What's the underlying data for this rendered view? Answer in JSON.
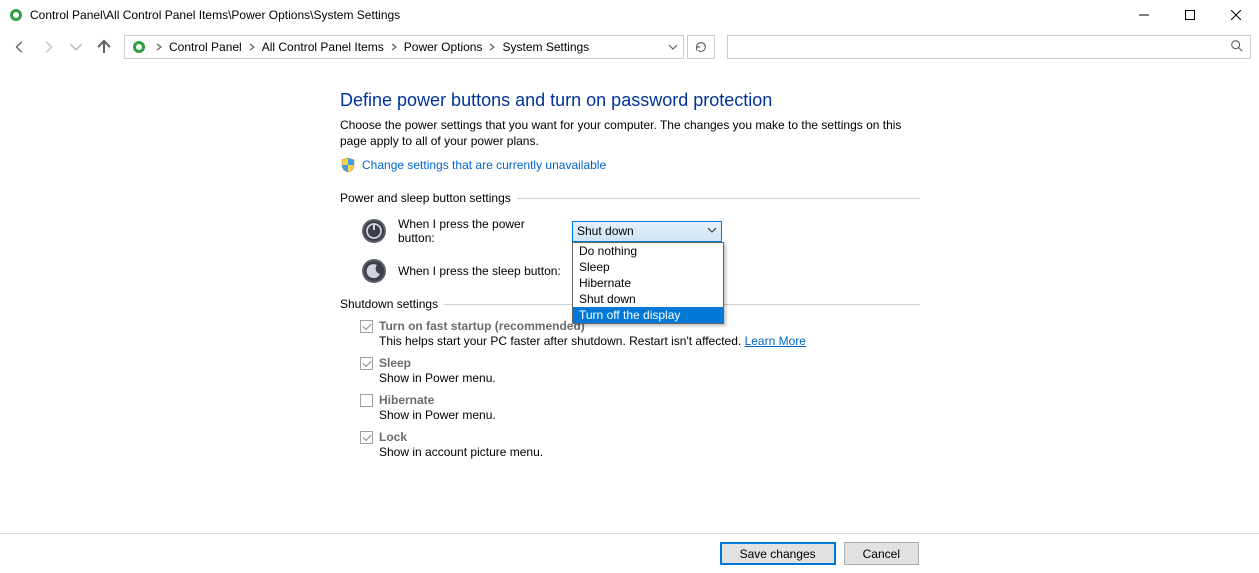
{
  "window": {
    "title": "Control Panel\\All Control Panel Items\\Power Options\\System Settings"
  },
  "breadcrumb": {
    "items": [
      "Control Panel",
      "All Control Panel Items",
      "Power Options",
      "System Settings"
    ]
  },
  "page": {
    "heading": "Define power buttons and turn on password protection",
    "description": "Choose the power settings that you want for your computer. The changes you make to the settings on this page apply to all of your power plans.",
    "admin_link": "Change settings that are currently unavailable"
  },
  "sections": {
    "buttons_label": "Power and sleep button settings",
    "shutdown_label": "Shutdown settings"
  },
  "power_button": {
    "label": "When I press the power button:",
    "selected": "Shut down",
    "options": [
      "Do nothing",
      "Sleep",
      "Hibernate",
      "Shut down",
      "Turn off the display"
    ],
    "highlighted_index": 4
  },
  "sleep_button": {
    "label": "When I press the sleep button:"
  },
  "shutdown": {
    "fast_startup": {
      "label": "Turn on fast startup (recommended)",
      "checked": true,
      "desc": "This helps start your PC faster after shutdown. Restart isn't affected. ",
      "learn_more": "Learn More"
    },
    "sleep": {
      "label": "Sleep",
      "checked": true,
      "desc": "Show in Power menu."
    },
    "hibernate": {
      "label": "Hibernate",
      "checked": false,
      "desc": "Show in Power menu."
    },
    "lock": {
      "label": "Lock",
      "checked": true,
      "desc": "Show in account picture menu."
    }
  },
  "footer": {
    "save": "Save changes",
    "cancel": "Cancel"
  }
}
